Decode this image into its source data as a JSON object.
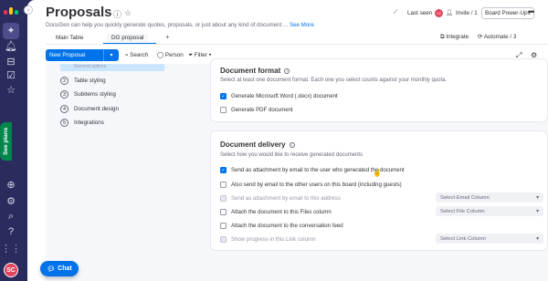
{
  "rail": {
    "icons": [
      "monday-logo-icon",
      "workspace-icon",
      "notifications-icon",
      "inbox-icon",
      "my-work-icon",
      "favorites-icon"
    ],
    "bottom_icons": [
      "invite-icon",
      "apps-icon",
      "search-icon",
      "help-icon"
    ],
    "see_plans_label": "See plans",
    "avatar_initials": "SC"
  },
  "header": {
    "title": "Proposals",
    "description": "DocuGen can help you quickly generate quotes, proposals, or just about any kind of document ...",
    "see_more": "See More",
    "last_seen_label": "Last seen",
    "last_seen_initials": "SC",
    "invite_label": "Invite / 1",
    "power_ups_label": "Board Power-Ups"
  },
  "tabs": {
    "items": [
      "Main Table",
      "DG proposal"
    ],
    "active": "DG proposal",
    "integrate_label": "Integrate",
    "automate_label": "Automate / 3"
  },
  "toolbar": {
    "new_label": "New Proposal",
    "search_label": "Search",
    "person_label": "Person",
    "filter_label": "Filter"
  },
  "steps": [
    {
      "num": "1",
      "label": "General options"
    },
    {
      "num": "2",
      "label": "Table styling"
    },
    {
      "num": "3",
      "label": "Subitems styling"
    },
    {
      "num": "4",
      "label": "Document design"
    },
    {
      "num": "5",
      "label": "Integrations"
    }
  ],
  "format": {
    "title": "Document format",
    "subtitle": "Select at least one document format. Each one you select counts against your monthly quota.",
    "options": [
      {
        "label": "Generate Microsoft Word (.docx) document",
        "checked": true
      },
      {
        "label": "Generate PDF document",
        "checked": false
      }
    ]
  },
  "delivery": {
    "title": "Document delivery",
    "subtitle": "Select how you would like to receive generated documents",
    "options": [
      {
        "label": "Send as attachment by email to the user who generated the document",
        "checked": true
      },
      {
        "label": "Also send by email to the other users on this board (including guests)",
        "checked": false
      },
      {
        "label": "Send as attachment by email to this address",
        "checked": false,
        "disabled": true,
        "select": "Select Email Column"
      },
      {
        "label": "Attach the document to this Files column",
        "checked": false,
        "select": "Select File Column"
      },
      {
        "label": "Attach the document to the conversation feed",
        "checked": false
      },
      {
        "label": "Show progress in this Link column",
        "checked": false,
        "disabled": true,
        "select": "Select Link Column"
      }
    ]
  },
  "chat_label": "Chat",
  "colors": {
    "primary": "#0073ea",
    "rail": "#2b2c5e",
    "green": "#00854d",
    "avatar": "#e2445c"
  }
}
